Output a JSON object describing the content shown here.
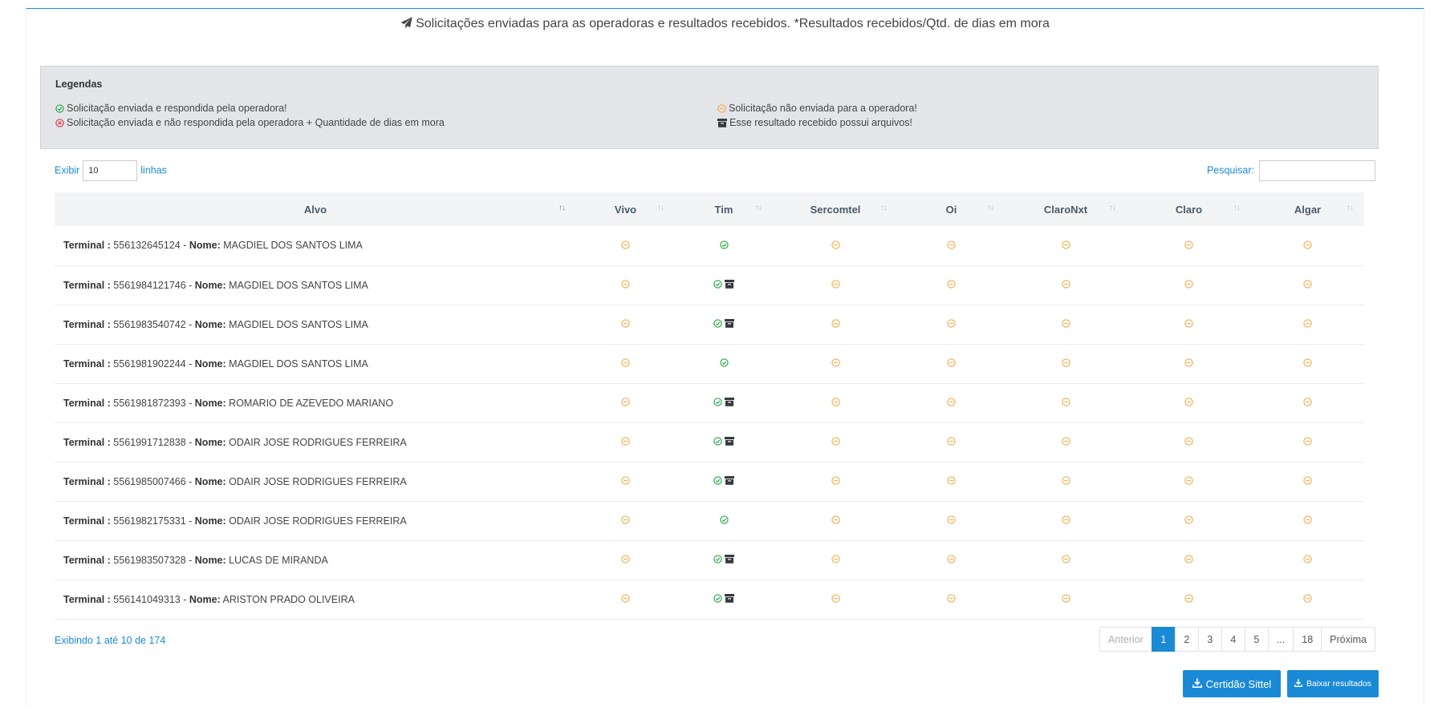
{
  "header": {
    "title": "Solicitações enviadas para as operadoras e resultados recebidos. *Resultados recebidos/Qtd. de dias em mora"
  },
  "legend": {
    "title": "Legendas",
    "items": [
      "Solicitação enviada e respondida pela operadora!",
      "Solicitação enviada e não respondida pela operadora + Quantidade de dias em mora",
      "Solicitação não enviada para a operadora!",
      "Esse resultado recebido possui arquivos!"
    ]
  },
  "controls": {
    "show_label": "Exibir",
    "show_value": "10",
    "rows_label": "linhas",
    "search_label": "Pesquisar:",
    "search_value": ""
  },
  "table": {
    "columns": [
      "Alvo",
      "Vivo",
      "Tim",
      "Sercomtel",
      "Oi",
      "ClaroNxt",
      "Claro",
      "Algar"
    ],
    "terminal_label": "Terminal :",
    "name_label": "Nome:",
    "rows": [
      {
        "terminal": "556132645124",
        "name": "MAGDIEL DOS SANTOS LIMA",
        "status": [
          "not_sent",
          "answered",
          "not_sent",
          "not_sent",
          "not_sent",
          "not_sent",
          "not_sent"
        ],
        "files": [
          false,
          false,
          false,
          false,
          false,
          false,
          false
        ]
      },
      {
        "terminal": "5561984121746",
        "name": "MAGDIEL DOS SANTOS LIMA",
        "status": [
          "not_sent",
          "answered",
          "not_sent",
          "not_sent",
          "not_sent",
          "not_sent",
          "not_sent"
        ],
        "files": [
          false,
          true,
          false,
          false,
          false,
          false,
          false
        ]
      },
      {
        "terminal": "5561983540742",
        "name": "MAGDIEL DOS SANTOS LIMA",
        "status": [
          "not_sent",
          "answered",
          "not_sent",
          "not_sent",
          "not_sent",
          "not_sent",
          "not_sent"
        ],
        "files": [
          false,
          true,
          false,
          false,
          false,
          false,
          false
        ]
      },
      {
        "terminal": "5561981902244",
        "name": "MAGDIEL DOS SANTOS LIMA",
        "status": [
          "not_sent",
          "answered",
          "not_sent",
          "not_sent",
          "not_sent",
          "not_sent",
          "not_sent"
        ],
        "files": [
          false,
          false,
          false,
          false,
          false,
          false,
          false
        ]
      },
      {
        "terminal": "5561981872393",
        "name": "ROMARIO DE AZEVEDO MARIANO",
        "status": [
          "not_sent",
          "answered",
          "not_sent",
          "not_sent",
          "not_sent",
          "not_sent",
          "not_sent"
        ],
        "files": [
          false,
          true,
          false,
          false,
          false,
          false,
          false
        ]
      },
      {
        "terminal": "5561991712838",
        "name": "ODAIR JOSE RODRIGUES FERREIRA",
        "status": [
          "not_sent",
          "answered",
          "not_sent",
          "not_sent",
          "not_sent",
          "not_sent",
          "not_sent"
        ],
        "files": [
          false,
          true,
          false,
          false,
          false,
          false,
          false
        ]
      },
      {
        "terminal": "5561985007466",
        "name": "ODAIR JOSE RODRIGUES FERREIRA",
        "status": [
          "not_sent",
          "answered",
          "not_sent",
          "not_sent",
          "not_sent",
          "not_sent",
          "not_sent"
        ],
        "files": [
          false,
          true,
          false,
          false,
          false,
          false,
          false
        ]
      },
      {
        "terminal": "5561982175331",
        "name": "ODAIR JOSE RODRIGUES FERREIRA",
        "status": [
          "not_sent",
          "answered",
          "not_sent",
          "not_sent",
          "not_sent",
          "not_sent",
          "not_sent"
        ],
        "files": [
          false,
          false,
          false,
          false,
          false,
          false,
          false
        ]
      },
      {
        "terminal": "5561983507328",
        "name": "LUCAS DE MIRANDA",
        "status": [
          "not_sent",
          "answered",
          "not_sent",
          "not_sent",
          "not_sent",
          "not_sent",
          "not_sent"
        ],
        "files": [
          false,
          true,
          false,
          false,
          false,
          false,
          false
        ]
      },
      {
        "terminal": "556141049313",
        "name": "ARISTON PRADO OLIVEIRA",
        "status": [
          "not_sent",
          "answered",
          "not_sent",
          "not_sent",
          "not_sent",
          "not_sent",
          "not_sent"
        ],
        "files": [
          false,
          true,
          false,
          false,
          false,
          false,
          false
        ]
      }
    ]
  },
  "footer": {
    "info": "Exibindo 1 até 10 de 174",
    "pages": [
      "Anterior",
      "1",
      "2",
      "3",
      "4",
      "5",
      "...",
      "18",
      "Próxima"
    ],
    "active_page": "1",
    "btn_certidao": "Certidão Sittel",
    "btn_baixar": "Baixar resultados"
  },
  "icons": {
    "answered": "check-circle-icon",
    "not_answered": "times-circle-icon",
    "not_sent": "minus-circle-icon",
    "files": "archive-icon",
    "title": "paper-plane-icon",
    "download": "download-icon"
  },
  "colors": {
    "accent": "#1b8ad6",
    "answered": "#28a745",
    "not_answered": "#dc3545",
    "not_sent": "#f0ad4e",
    "archive": "#343a40"
  }
}
